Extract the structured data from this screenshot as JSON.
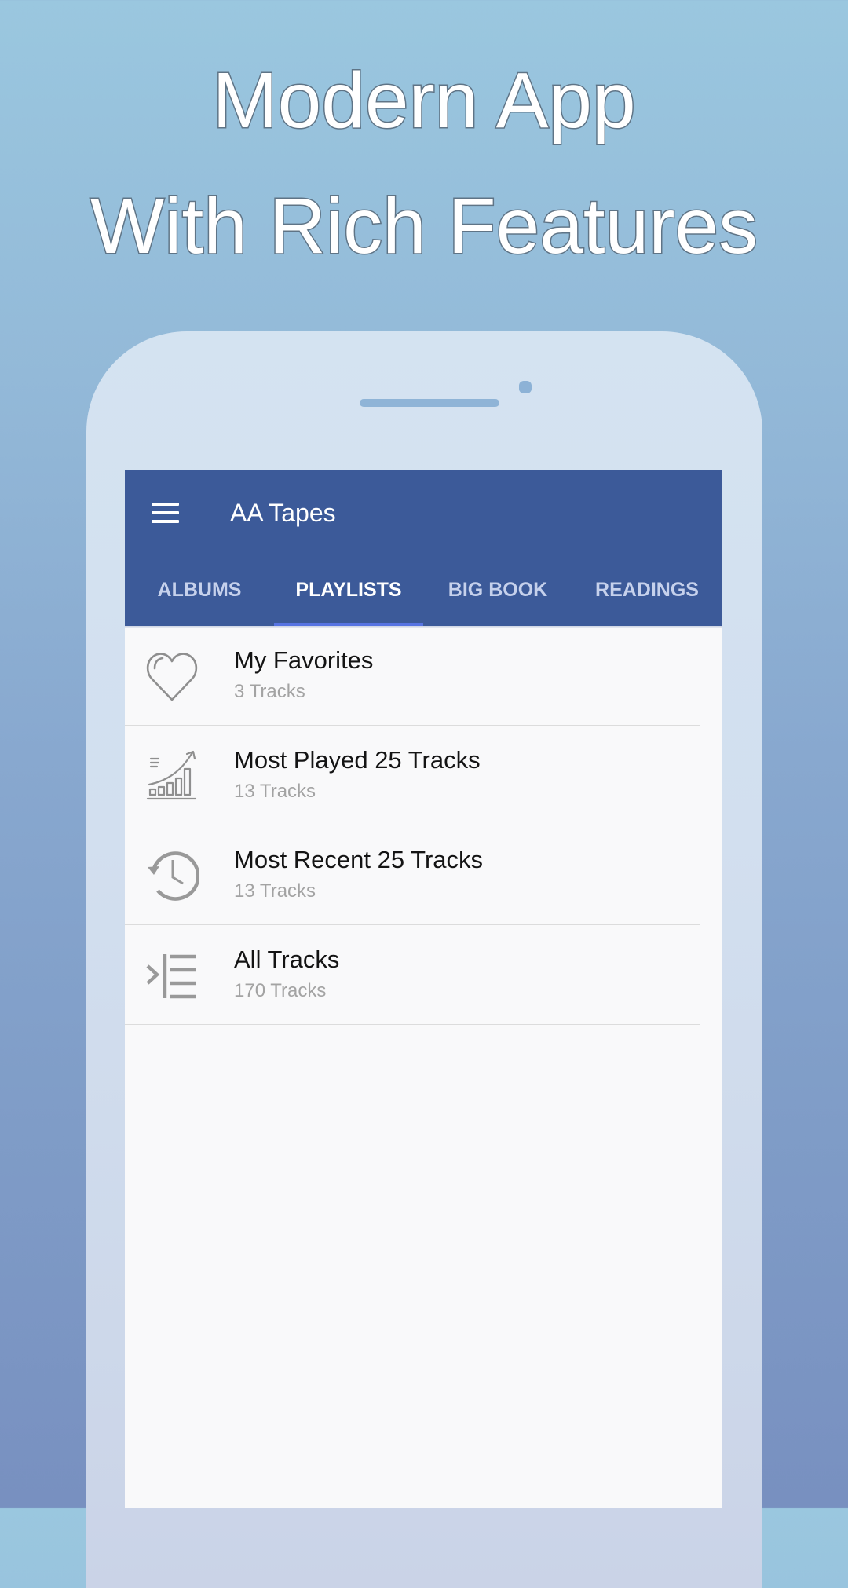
{
  "promo": {
    "line1": "Modern App",
    "line2": "With Rich Features"
  },
  "app": {
    "title": "AA Tapes",
    "menu_icon": "hamburger-menu-icon",
    "colors": {
      "appbar": "#3c5a99",
      "tab_indicator": "#5774e2",
      "tab_inactive": "#c6d1ec",
      "tab_active": "#ffffff"
    }
  },
  "tabs": [
    {
      "label": "ALBUMS",
      "active": false
    },
    {
      "label": "PLAYLISTS",
      "active": true
    },
    {
      "label": "BIG BOOK",
      "active": false
    },
    {
      "label": "READINGS",
      "active": false
    }
  ],
  "playlists": [
    {
      "title": "My Favorites",
      "subtitle": "3 Tracks",
      "icon": "heart-icon"
    },
    {
      "title": "Most Played 25 Tracks",
      "subtitle": "13 Tracks",
      "icon": "trending-chart-icon"
    },
    {
      "title": "Most Recent 25 Tracks",
      "subtitle": "13 Tracks",
      "icon": "history-clock-icon"
    },
    {
      "title": "All Tracks",
      "subtitle": "170 Tracks",
      "icon": "list-indent-icon"
    }
  ]
}
